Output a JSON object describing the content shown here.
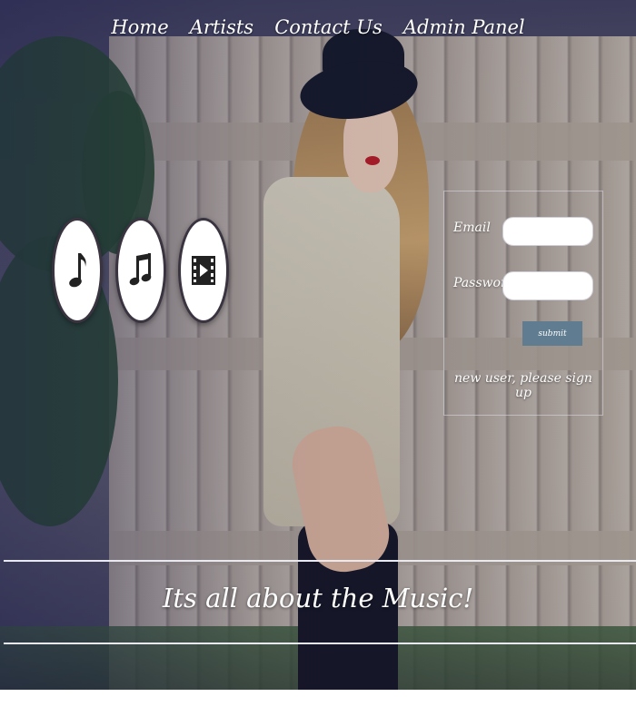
{
  "nav": {
    "items": [
      {
        "label": "Home"
      },
      {
        "label": "Artists"
      },
      {
        "label": "Contact Us"
      },
      {
        "label": "Admin Panel"
      }
    ]
  },
  "feature_icons": [
    "music-note-icon",
    "music-notes-icon",
    "video-player-icon"
  ],
  "login": {
    "email_label": "Email",
    "email_value": "",
    "password_label": "Password",
    "password_value": "",
    "submit_label": "submit",
    "signup_text": "new user, please sign up"
  },
  "tagline": "Its all about the Music!",
  "colors": {
    "submit": "#5f7c90",
    "text": "#ffffff",
    "overlay": "#1e1e50"
  }
}
